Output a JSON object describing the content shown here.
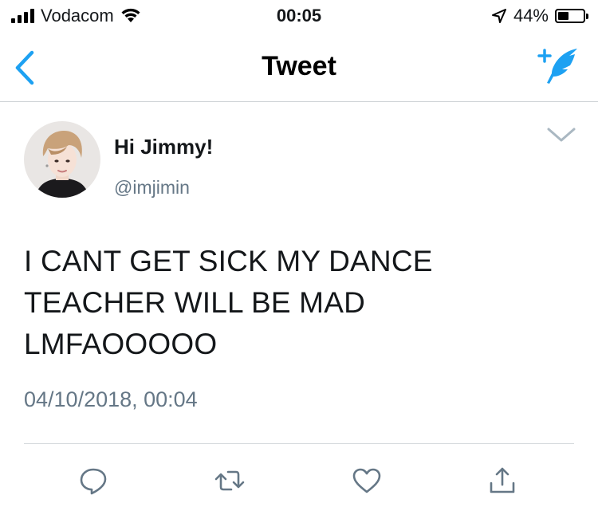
{
  "status_bar": {
    "carrier": "Vodacom",
    "time": "00:05",
    "battery_percent": "44%",
    "battery_level": 0.44
  },
  "nav": {
    "title": "Tweet",
    "back_icon": "chevron-left-icon",
    "compose_icon": "compose-tweet-icon"
  },
  "tweet": {
    "display_name": "Hi Jimmy!",
    "handle": "@imjimin",
    "text": "I CANT GET SICK MY DANCE TEACHER WILL BE MAD LMFAOOOOO",
    "timestamp": "04/10/2018, 00:04"
  },
  "actions": [
    {
      "icon": "reply-icon"
    },
    {
      "icon": "retweet-icon"
    },
    {
      "icon": "like-icon"
    },
    {
      "icon": "share-icon"
    }
  ],
  "colors": {
    "accent": "#1da1f2",
    "text_primary": "#14171a",
    "text_secondary": "#657786",
    "icon_gray": "#657786",
    "divider": "#d6dadd"
  }
}
